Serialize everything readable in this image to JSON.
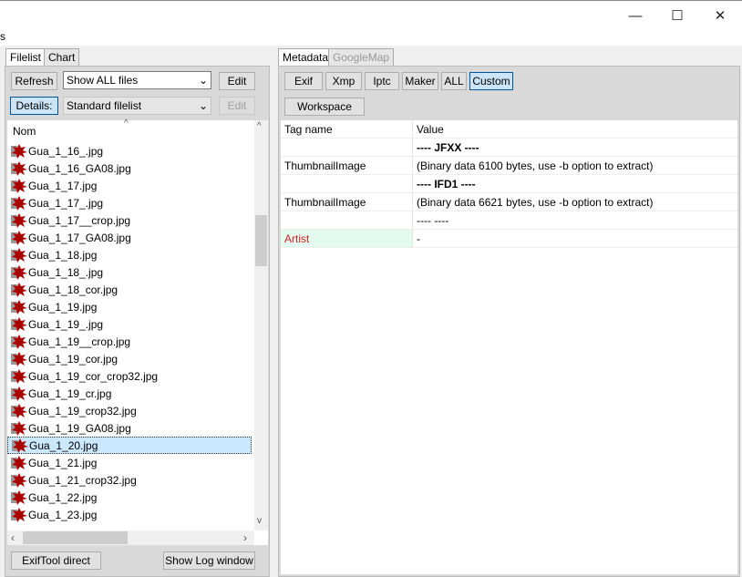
{
  "window": {
    "minimize": "—",
    "maximize": "☐",
    "close": "✕",
    "menu_fragment": "s"
  },
  "left": {
    "tabs": [
      {
        "label": "Filelist",
        "active": true
      },
      {
        "label": "Chart",
        "active": false
      }
    ],
    "refresh": "Refresh",
    "filter": "Show ALL files",
    "edit1": "Edit",
    "details": "Details:",
    "view": "Standard filelist",
    "edit2": "Edit",
    "column": "Nom",
    "files": [
      "Gua_1_16_.jpg",
      "Gua_1_16_GA08.jpg",
      "Gua_1_17.jpg",
      "Gua_1_17_.jpg",
      "Gua_1_17__crop.jpg",
      "Gua_1_17_GA08.jpg",
      "Gua_1_18.jpg",
      "Gua_1_18_.jpg",
      "Gua_1_18_cor.jpg",
      "Gua_1_19.jpg",
      "Gua_1_19_.jpg",
      "Gua_1_19__crop.jpg",
      "Gua_1_19_cor.jpg",
      "Gua_1_19_cor_crop32.jpg",
      "Gua_1_19_cr.jpg",
      "Gua_1_19_crop32.jpg",
      "Gua_1_19_GA08.jpg",
      "Gua_1_20.jpg",
      "Gua_1_21.jpg",
      "Gua_1_21_crop32.jpg",
      "Gua_1_22.jpg",
      "Gua_1_23.jpg"
    ],
    "selected": "Gua_1_20.jpg",
    "exiftool_direct": "ExifTool direct",
    "show_log": "Show Log window"
  },
  "right": {
    "tabs": [
      {
        "label": "Metadata",
        "active": true
      },
      {
        "label": "GoogleMap",
        "active": false
      }
    ],
    "groups": [
      "Exif",
      "Xmp",
      "Iptc",
      "Maker",
      "ALL",
      "Custom"
    ],
    "selected_group": "Custom",
    "workspace": "Workspace",
    "headers": {
      "tag": "Tag name",
      "value": "Value"
    },
    "rows": [
      {
        "tag": "",
        "value": "---- JFXX ----",
        "bold": true
      },
      {
        "tag": "ThumbnailImage",
        "value": "(Binary data 6100 bytes, use -b option to extract)"
      },
      {
        "tag": "",
        "value": "---- IFD1 ----",
        "bold": true
      },
      {
        "tag": "ThumbnailImage",
        "value": "(Binary data 6621 bytes, use -b option to extract)"
      },
      {
        "tag": "",
        "value": "----  ----"
      },
      {
        "tag": "Artist",
        "value": "-",
        "highlight": true
      }
    ]
  },
  "colors": {
    "selection": "#cce8ff",
    "artist_text": "#cc2222",
    "artist_bg": "#e3fbef"
  }
}
